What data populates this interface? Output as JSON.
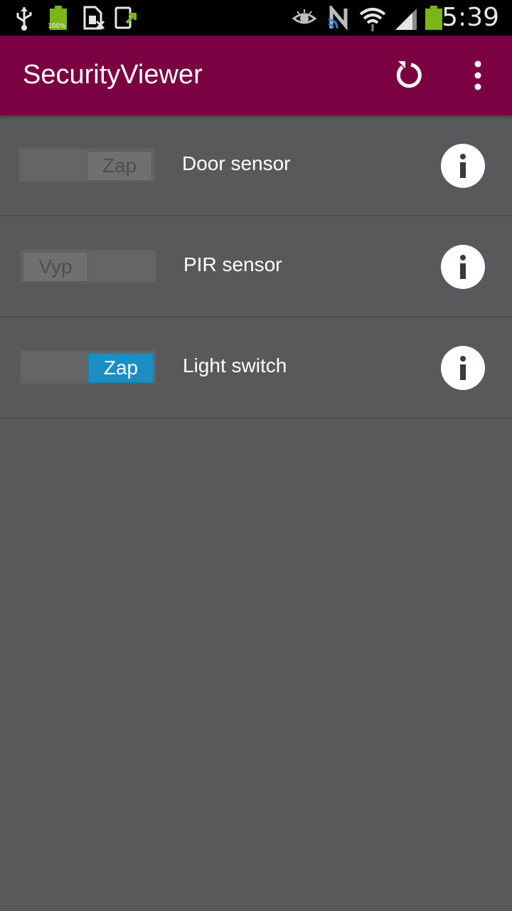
{
  "status_bar": {
    "time": "5:39",
    "battery_small_label": "100%",
    "icons": [
      "usb-icon",
      "battery-full-icon",
      "sim-card-icon",
      "screen-share-icon",
      "eye-icon",
      "nfc-icon",
      "wifi-icon",
      "signal-icon",
      "battery-icon"
    ]
  },
  "action_bar": {
    "title": "SecurityViewer",
    "refresh_icon": "refresh-icon",
    "overflow_icon": "overflow-menu-icon",
    "color": "#7a0042"
  },
  "devices": [
    {
      "label": "Door sensor",
      "toggle_text": "Zap",
      "state": "disabled-on",
      "info_icon": "info-icon"
    },
    {
      "label": "PIR sensor",
      "toggle_text": "Vyp",
      "state": "disabled-off",
      "info_icon": "info-icon"
    },
    {
      "label": "Light switch",
      "toggle_text": "Zap",
      "state": "on",
      "info_icon": "info-icon"
    }
  ],
  "colors": {
    "background": "#58595b",
    "accent_on": "#1b8fc4"
  }
}
